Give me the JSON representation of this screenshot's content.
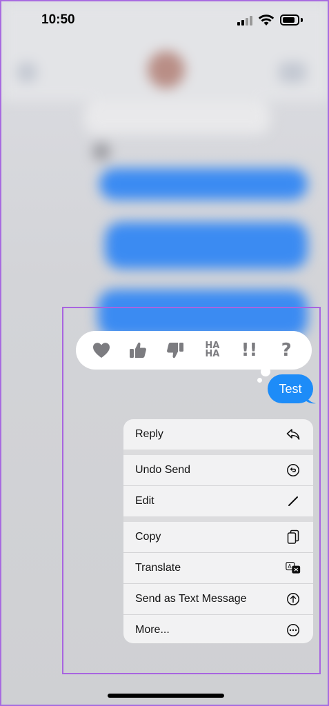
{
  "status_bar": {
    "time": "10:50"
  },
  "tapback": {
    "reactions": [
      {
        "name": "heart-icon",
        "label": ""
      },
      {
        "name": "thumbs-up-icon",
        "label": ""
      },
      {
        "name": "thumbs-down-icon",
        "label": ""
      },
      {
        "name": "haha-icon",
        "label": "HA HA"
      },
      {
        "name": "exclamation-icon",
        "label": "!!"
      },
      {
        "name": "question-icon",
        "label": "?"
      }
    ],
    "haha_top": "HA",
    "haha_bottom": "HA",
    "emphasize": "!!",
    "question": "?"
  },
  "message": {
    "text": "Test",
    "color": "#1d8cf8"
  },
  "menu": {
    "items": [
      {
        "label": "Reply",
        "icon": "reply-icon"
      },
      {
        "label": "Undo Send",
        "icon": "undo-icon"
      },
      {
        "label": "Edit",
        "icon": "pencil-icon"
      },
      {
        "label": "Copy",
        "icon": "copy-icon"
      },
      {
        "label": "Translate",
        "icon": "translate-icon"
      },
      {
        "label": "Send as Text Message",
        "icon": "arrow-up-circle-icon"
      },
      {
        "label": "More...",
        "icon": "more-icon"
      }
    ]
  },
  "colors": {
    "highlight_outline": "#a864e0",
    "bubble_blue": "#1d8cf8",
    "icon_grey": "#7c7c80"
  }
}
